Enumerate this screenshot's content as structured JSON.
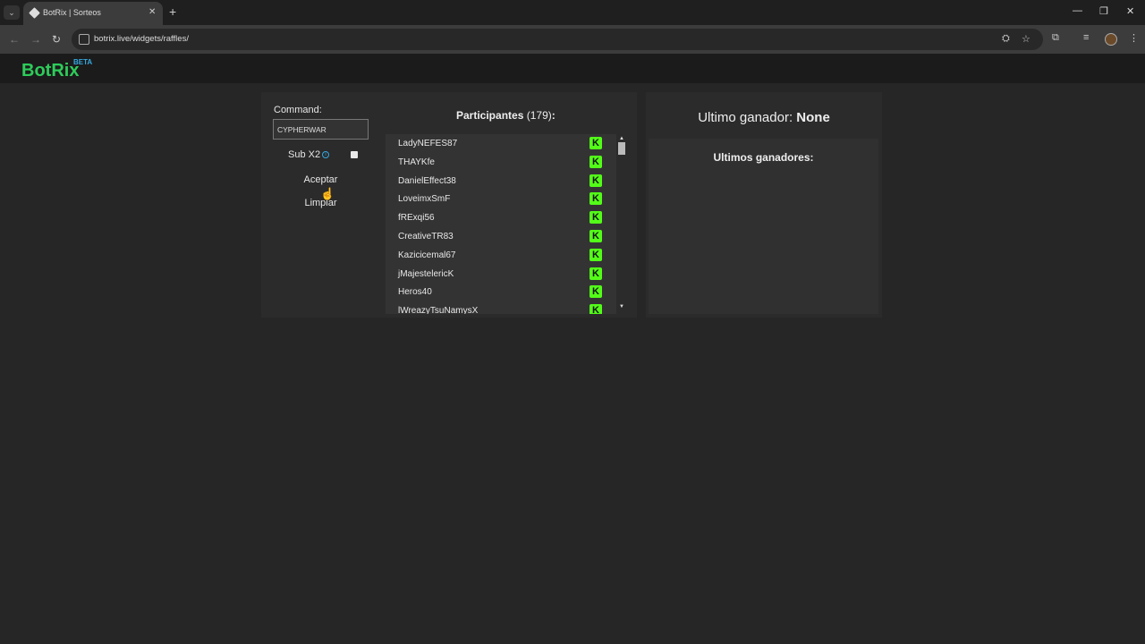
{
  "browser": {
    "tab_title": "BotRix | Sorteos",
    "url": "botrix.live/widgets/raffles/"
  },
  "site": {
    "logo": "BotRix",
    "badge": "BETA"
  },
  "form": {
    "command_label": "Command:",
    "command_value": "CYPHERWAR",
    "sub_label": "Sub X2",
    "accept_label": "Aceptar",
    "clear_label": "Limpiar"
  },
  "participants": {
    "title": "Participantes",
    "count": "(179)",
    "colon": ":",
    "items": [
      "LadyNEFES87",
      "THAYKfe",
      "DanielEffect38",
      "LoveimxSmF",
      "fRExqi56",
      "CreativeTR83",
      "Kazicicemal67",
      "jMajestelericK",
      "Heros40",
      "lWreazyTsuNamysX"
    ],
    "platform_icon": "kick-icon"
  },
  "winners": {
    "last_label": "Ultimo ganador:",
    "last_value": "None",
    "list_title": "Ultimos ganadores:"
  },
  "colors": {
    "brand": "#2ecc5a",
    "kick": "#53fc18",
    "beta": "#35a8e0"
  }
}
